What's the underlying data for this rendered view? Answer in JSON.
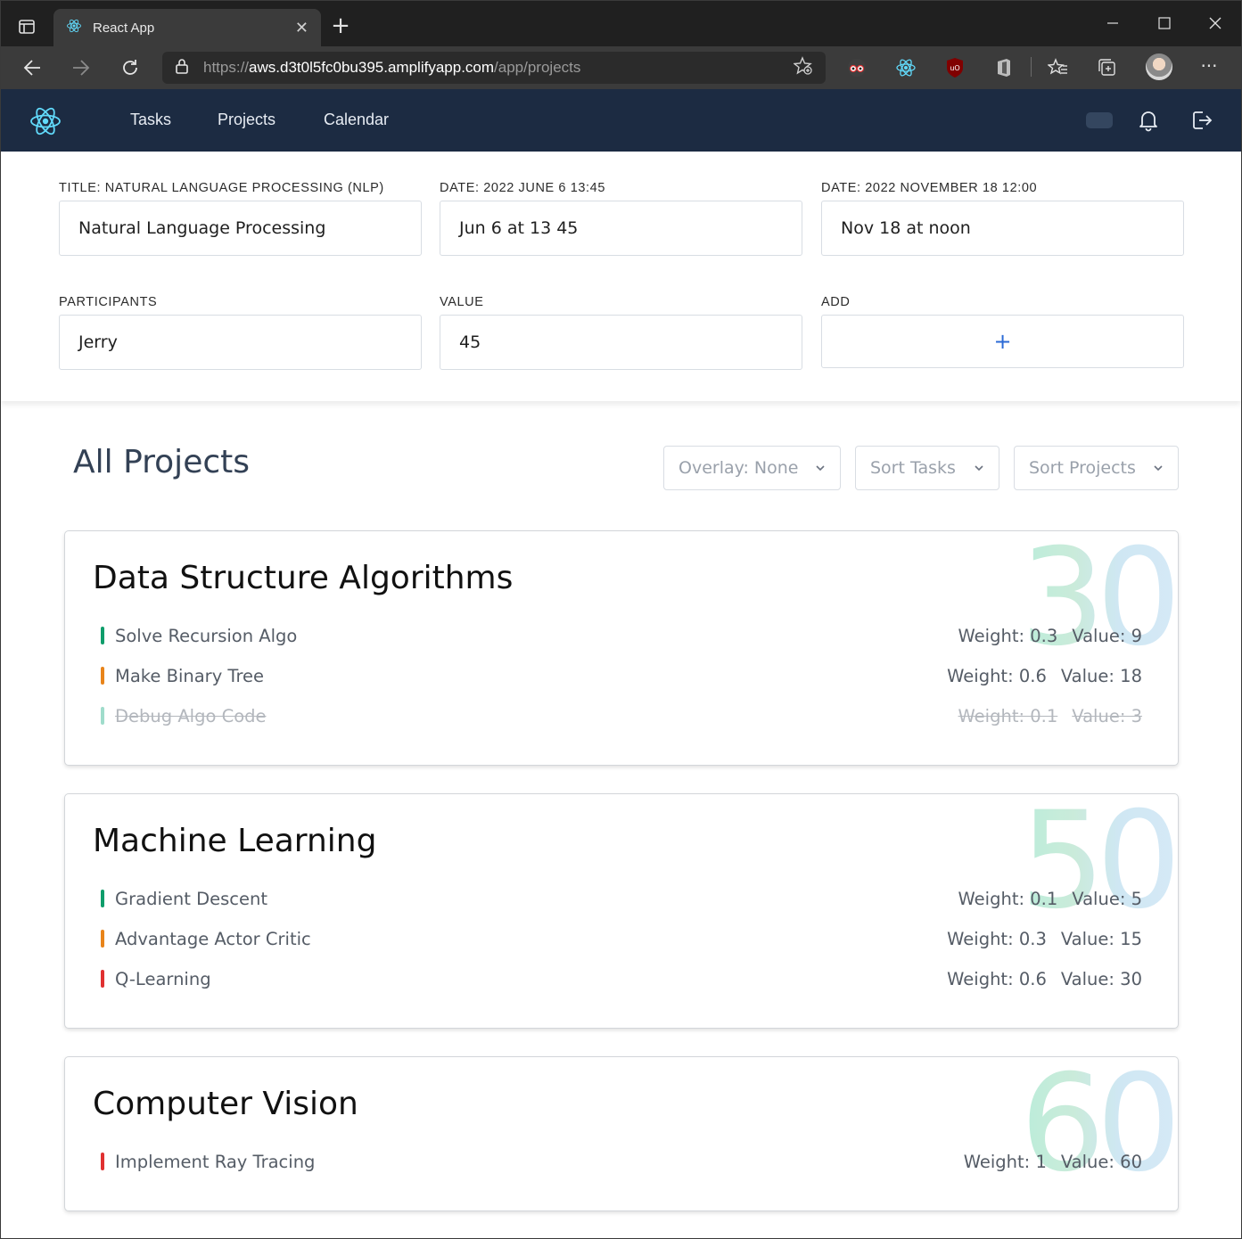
{
  "browser": {
    "tab_title": "React App",
    "tab_close": "✕",
    "new_tab": "+",
    "url_prefix": "https://",
    "url_host": "aws.d3t0l5fc0bu395.amplifyapp.com",
    "url_path": "/app/projects",
    "more_label": "···"
  },
  "nav": {
    "items": [
      "Tasks",
      "Projects",
      "Calendar"
    ]
  },
  "form": {
    "fields": [
      {
        "label": "TITLE: NATURAL LANGUAGE PROCESSING (NLP)",
        "value": "Natural Language Processing"
      },
      {
        "label": "DATE: 2022 JUNE 6 13:45",
        "value": "Jun 6 at 13 45"
      },
      {
        "label": "DATE: 2022 NOVEMBER 18 12:00",
        "value": "Nov 18 at noon"
      },
      {
        "label": "PARTICIPANTS",
        "value": "Jerry"
      },
      {
        "label": "VALUE",
        "value": "45"
      },
      {
        "label": "ADD",
        "value": "+"
      }
    ]
  },
  "projects_section": {
    "title": "All Projects",
    "dropdowns": [
      "Overlay: None",
      "Sort Tasks",
      "Sort Projects"
    ],
    "caret": "⌄"
  },
  "projects": [
    {
      "name": "Data Structure Algorithms",
      "total": "30",
      "tasks": [
        {
          "name": "Solve Recursion Algo",
          "weight": "Weight: 0.3",
          "value": "Value: 9",
          "color": "#0f9d6b",
          "done": false
        },
        {
          "name": "Make Binary Tree",
          "weight": "Weight: 0.6",
          "value": "Value: 18",
          "color": "#e8841a",
          "done": false
        },
        {
          "name": "Debug Algo Code",
          "weight": "Weight: 0.1",
          "value": "Value: 3",
          "color": "#9fdccb",
          "done": true
        }
      ]
    },
    {
      "name": "Machine Learning",
      "total": "50",
      "tasks": [
        {
          "name": "Gradient Descent",
          "weight": "Weight: 0.1",
          "value": "Value: 5",
          "color": "#0f9d6b",
          "done": false
        },
        {
          "name": "Advantage Actor Critic",
          "weight": "Weight: 0.3",
          "value": "Value: 15",
          "color": "#e8841a",
          "done": false
        },
        {
          "name": "Q-Learning",
          "weight": "Weight: 0.6",
          "value": "Value: 30",
          "color": "#e03131",
          "done": false
        }
      ]
    },
    {
      "name": "Computer Vision",
      "total": "60",
      "tasks": [
        {
          "name": "Implement Ray Tracing",
          "weight": "Weight: 1",
          "value": "Value: 60",
          "color": "#e03131",
          "done": false
        }
      ]
    }
  ]
}
